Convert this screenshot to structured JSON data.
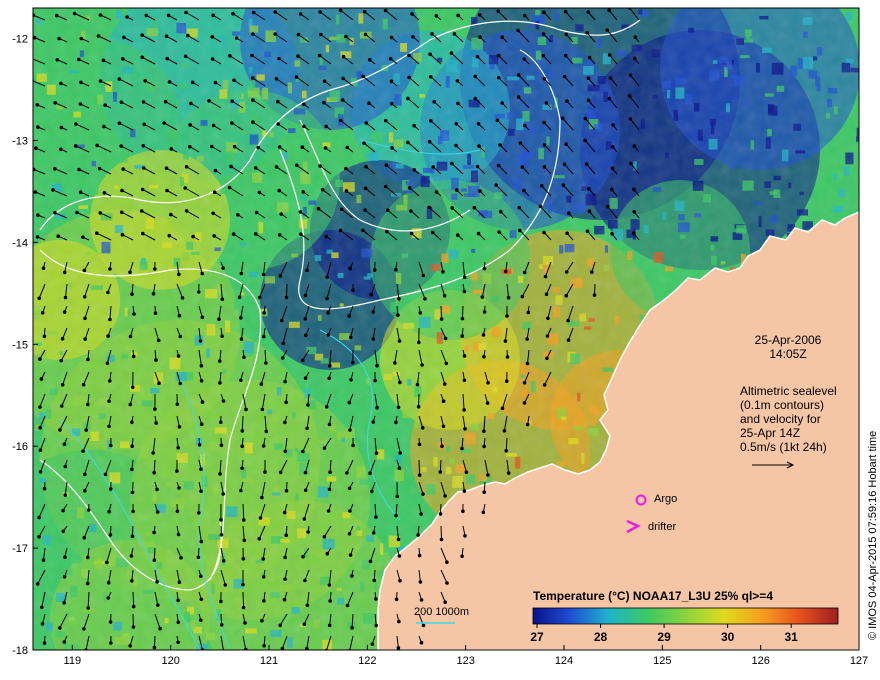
{
  "map": {
    "lon_range": [
      118.6,
      127.0
    ],
    "lat_range": [
      -18.0,
      -11.7
    ],
    "x_ticks": [
      "119",
      "120",
      "121",
      "122",
      "123",
      "124",
      "125",
      "126",
      "127"
    ],
    "y_ticks": [
      "-12",
      "-13",
      "-14",
      "-15",
      "-16",
      "-17",
      "-18"
    ],
    "land_color": "#f5c6a5",
    "ocean_palette": [
      "#08108c",
      "#1e50d2",
      "#20b4c8",
      "#3cc864",
      "#8cd23c",
      "#dcdc1e",
      "#f5a01e",
      "#e6501e",
      "#a01e1e"
    ]
  },
  "info": {
    "date": "25-Apr-2006",
    "time": "14:05Z",
    "altimetry_lines": [
      "Altimetric sealevel",
      "(0.1m contours)",
      "and velocity for",
      "25-Apr 14Z",
      "0.5m/s (1kt 24h)"
    ]
  },
  "markers": {
    "argo_label": "Argo",
    "drifter_label": "drifter",
    "marker_color": "#e61ee6"
  },
  "depth_legend": {
    "label": "200  1000m"
  },
  "colorbar": {
    "title": "Temperature (°C) NOAA17_L3U 25% ql>=4",
    "ticks": [
      "27",
      "28",
      "29",
      "30",
      "31"
    ],
    "min": 27,
    "max": 31.8
  },
  "credit": "© IMOS 04-Apr-2015 07:59:16 Hobart time"
}
